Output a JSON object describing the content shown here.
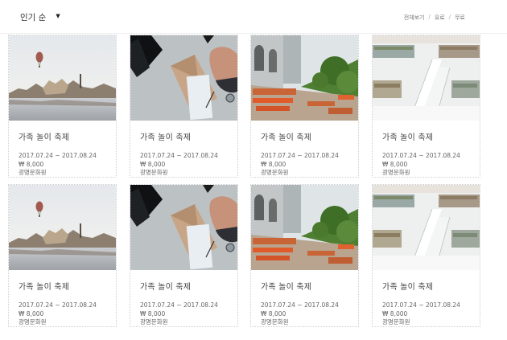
{
  "header": {
    "sort_label": "인기 순",
    "sort_caret": "▼",
    "filters": [
      "전체보기",
      "유료",
      "무료"
    ],
    "separator": "/"
  },
  "cards": [
    {
      "image": "balloon-lake",
      "title": "가족 놀이 축제",
      "dates": "2017.07.24 ~ 2017.08.24",
      "price": "₩ 8,000",
      "venue": "광명문화원"
    },
    {
      "image": "desk-envelope",
      "title": "가족 놀이 축제",
      "dates": "2017.07.24 ~ 2017.08.24",
      "price": "₩ 8,000",
      "venue": "광명문화원"
    },
    {
      "image": "street-cafe",
      "title": "가족 놀이 축제",
      "dates": "2017.07.24 ~ 2017.08.24",
      "price": "₩ 8,000",
      "venue": "광명문화원"
    },
    {
      "image": "library-stairs",
      "title": "가족 놀이 축제",
      "dates": "2017.07.24 ~ 2017.08.24",
      "price": "₩ 8,000",
      "venue": "광명문화원"
    },
    {
      "image": "balloon-lake",
      "title": "가족 놀이 축제",
      "dates": "2017.07.24 ~ 2017.08.24",
      "price": "₩ 8,000",
      "venue": "광명문화원"
    },
    {
      "image": "desk-envelope",
      "title": "가족 놀이 축제",
      "dates": "2017.07.24 ~ 2017.08.24",
      "price": "₩ 8,000",
      "venue": "광명문화원"
    },
    {
      "image": "street-cafe",
      "title": "가족 놀이 축제",
      "dates": "2017.07.24 ~ 2017.08.24",
      "price": "₩ 8,000",
      "venue": "광명문화원"
    },
    {
      "image": "library-stairs",
      "title": "가족 놀이 축제",
      "dates": "2017.07.24 ~ 2017.08.24",
      "price": "₩ 8,000",
      "venue": "광명문화원"
    }
  ]
}
